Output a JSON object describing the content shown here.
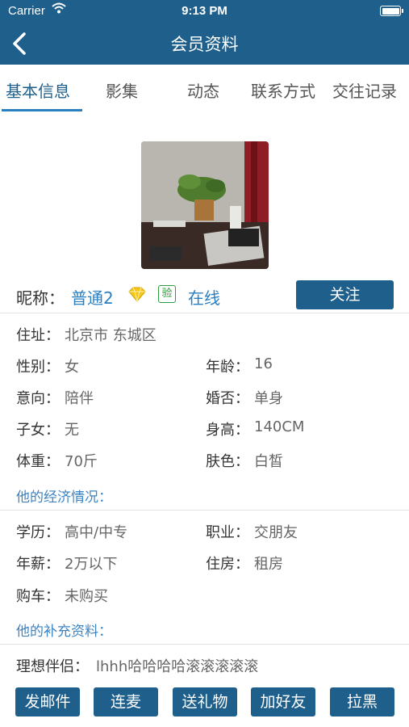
{
  "status_bar": {
    "carrier": "Carrier",
    "time": "9:13 PM"
  },
  "nav": {
    "title": "会员资料"
  },
  "tabs": [
    {
      "label": "基本信息"
    },
    {
      "label": "影集"
    },
    {
      "label": "动态"
    },
    {
      "label": "联系方式"
    },
    {
      "label": "交往记录"
    }
  ],
  "profile": {
    "nickname_label": "昵称：",
    "nickname": "普通2",
    "verify_badge": "验",
    "online_status": "在线",
    "follow_button": "关注",
    "vip_icon": "diamond-icon",
    "address_label": "住址：",
    "address": "北京市 东城区",
    "basic": [
      {
        "label": "性别：",
        "value": "女"
      },
      {
        "label": "年龄：",
        "value": "16"
      },
      {
        "label": "意向：",
        "value": "陪伴"
      },
      {
        "label": "婚否：",
        "value": "单身"
      },
      {
        "label": "子女：",
        "value": "无"
      },
      {
        "label": "身高：",
        "value": "140CM"
      },
      {
        "label": "体重：",
        "value": "70斤"
      },
      {
        "label": "肤色：",
        "value": "白皙"
      }
    ]
  },
  "economy": {
    "title": "他的经济情况：",
    "items": [
      {
        "label": "学历：",
        "value": "高中/中专"
      },
      {
        "label": "职业：",
        "value": "交朋友"
      },
      {
        "label": "年薪：",
        "value": "2万以下"
      },
      {
        "label": "住房：",
        "value": "租房"
      },
      {
        "label": "购车：",
        "value": "未购买"
      }
    ]
  },
  "supplement": {
    "title": "他的补充资料：",
    "ideal_partner_label": "理想伴侣：",
    "ideal_partner": "lhhh哈哈哈哈滚滚滚滚滚"
  },
  "actions": [
    {
      "label": "发邮件"
    },
    {
      "label": "连麦"
    },
    {
      "label": "送礼物"
    },
    {
      "label": "加好友"
    },
    {
      "label": "拉黑"
    }
  ],
  "colors": {
    "primary": "#1f5f8b",
    "accent": "#2a7fc1",
    "section_title": "#3b84c4",
    "verify": "#2e9b3e",
    "vip": "#f5c518"
  }
}
